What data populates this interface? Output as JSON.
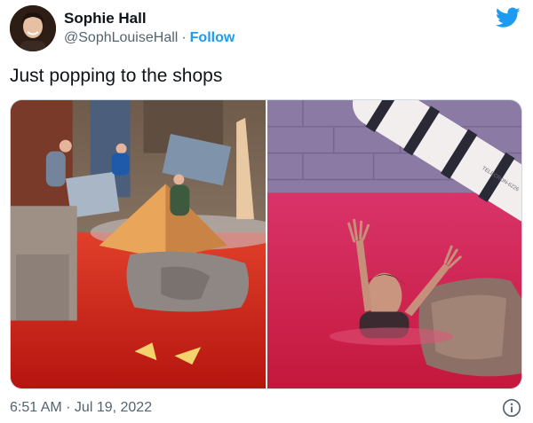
{
  "author": {
    "display_name": "Sophie Hall",
    "handle": "@SophLouiseHall",
    "separator": "·",
    "follow_label": "Follow",
    "avatar_icon": "profile-photo"
  },
  "brand": {
    "icon": "twitter-bird-icon",
    "color": "#1d9bf0"
  },
  "tweet": {
    "text": "Just popping to the shops"
  },
  "media": {
    "left_image": "game-show-set-red-floor",
    "right_image": "person-in-red-water",
    "pipe_text": "TELECRON-6226"
  },
  "footer": {
    "timestamp": "6:51 AM · Jul 19, 2022",
    "info_icon": "info-icon"
  }
}
